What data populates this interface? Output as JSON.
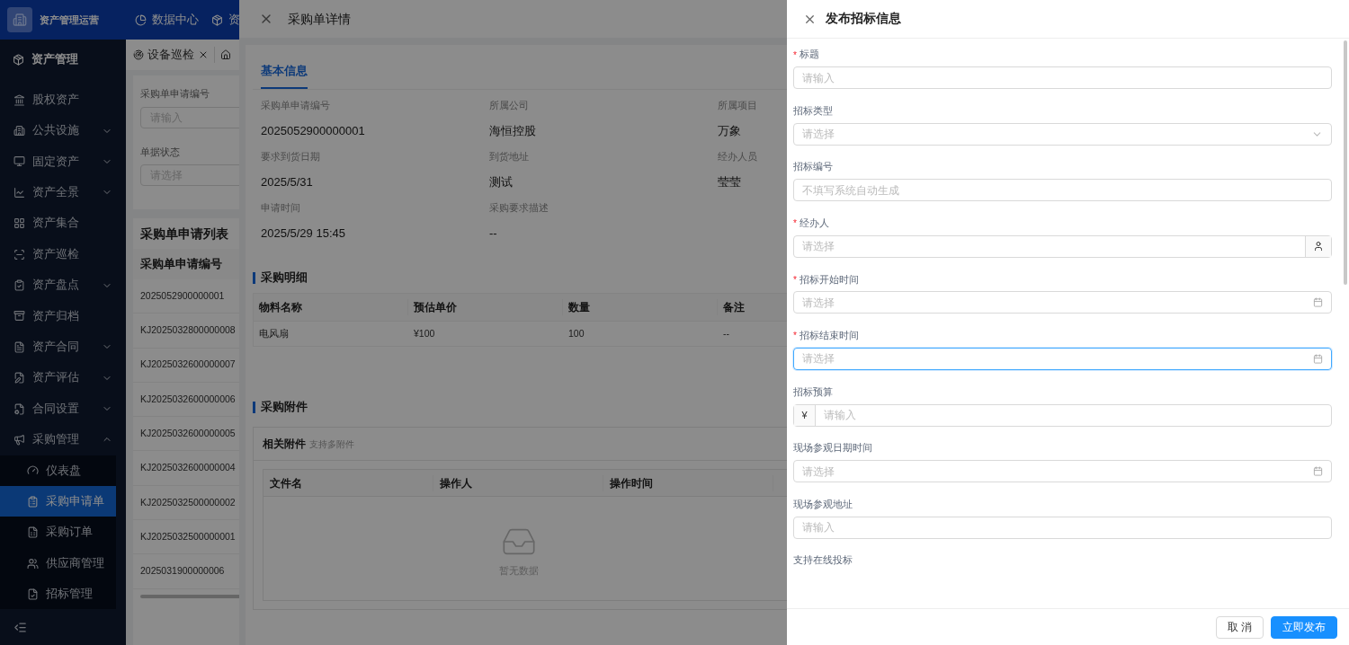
{
  "topbar": {
    "app_name": "资产管理运营",
    "nav": [
      {
        "label": "数据中心"
      },
      {
        "label": "资"
      }
    ]
  },
  "sidebar": {
    "title": "资产管理",
    "items": [
      {
        "label": "股权资产",
        "expandable": false,
        "selected": false
      },
      {
        "label": "公共设施",
        "expandable": true,
        "expanded": false,
        "selected": false
      },
      {
        "label": "固定资产",
        "expandable": true,
        "expanded": false,
        "selected": false
      },
      {
        "label": "资产全景",
        "expandable": true,
        "expanded": false,
        "selected": false
      },
      {
        "label": "资产集合",
        "expandable": false,
        "selected": false
      },
      {
        "label": "资产巡检",
        "expandable": false,
        "selected": false
      },
      {
        "label": "资产盘点",
        "expandable": true,
        "expanded": false,
        "selected": false
      },
      {
        "label": "资产归档",
        "expandable": false,
        "selected": false
      },
      {
        "label": "资产合同",
        "expandable": true,
        "expanded": false,
        "selected": false
      },
      {
        "label": "资产评估",
        "expandable": true,
        "expanded": false,
        "selected": false
      },
      {
        "label": "合同设置",
        "expandable": true,
        "expanded": false,
        "selected": false
      },
      {
        "label": "采购管理",
        "expandable": true,
        "expanded": true,
        "selected": false,
        "children": [
          {
            "label": "仪表盘",
            "selected": false
          },
          {
            "label": "采购申请单",
            "selected": true
          },
          {
            "label": "采购订单",
            "selected": false
          },
          {
            "label": "供应商管理",
            "selected": false
          },
          {
            "label": "招标管理",
            "selected": false
          }
        ]
      }
    ]
  },
  "page_tabs": [
    {
      "label": "设备巡检",
      "closable": true
    }
  ],
  "filters": [
    {
      "label": "采购单申请编号",
      "placeholder": "请输入"
    },
    {
      "label": "单据状态",
      "placeholder": "请选择"
    }
  ],
  "list": {
    "title": "采购单申请列表",
    "column": "采购单申请编号",
    "rows": [
      "2025052900000001",
      "KJ2025032800000008",
      "KJ2025032600000007",
      "KJ2025032600000006",
      "KJ2025032600000005",
      "KJ2025032600000004",
      "KJ2025032500000002",
      "KJ2025032500000001",
      "2025031900000006"
    ]
  },
  "detail_drawer": {
    "title": "采购单详情",
    "tabs": [
      {
        "label": "基本信息",
        "selected": true
      }
    ],
    "fields": [
      {
        "label": "采购单申请编号",
        "value": "2025052900000001"
      },
      {
        "label": "所属公司",
        "value": "海恒控股"
      },
      {
        "label": "所属项目",
        "value": "万象"
      },
      {
        "label": "要求到货日期",
        "value": "2025/5/31"
      },
      {
        "label": "到货地址",
        "value": "测试"
      },
      {
        "label": "经办人员",
        "value": "莹莹"
      },
      {
        "label": "申请时间",
        "value": "2025/5/29 15:45"
      },
      {
        "label": "采购要求描述",
        "value": "--"
      }
    ],
    "items_section": {
      "title": "采购明细",
      "columns": [
        "物料名称",
        "预估单价",
        "数量",
        "备注"
      ],
      "rows": [
        [
          "电风扇",
          "¥100",
          "100",
          "--"
        ]
      ]
    },
    "attachments_section": {
      "title": "采购附件",
      "box_title": "相关附件",
      "box_hint": "支持多附件",
      "columns": [
        "文件名",
        "操作人",
        "操作时间"
      ],
      "empty_text": "暂无数据"
    }
  },
  "publish_drawer": {
    "title": "发布招标信息",
    "required_mark": "*",
    "fields": [
      {
        "label": "标题",
        "required": true,
        "kind": "input",
        "placeholder": "请输入",
        "focused": false
      },
      {
        "label": "招标类型",
        "required": false,
        "kind": "select",
        "placeholder": "请选择",
        "focused": false
      },
      {
        "label": "招标编号",
        "required": false,
        "kind": "input",
        "placeholder": "不填写系统自动生成",
        "focused": false
      },
      {
        "label": "经办人",
        "required": true,
        "kind": "person",
        "placeholder": "请选择",
        "focused": false
      },
      {
        "label": "招标开始时间",
        "required": true,
        "kind": "date",
        "placeholder": "请选择",
        "focused": false
      },
      {
        "label": "招标结束时间",
        "required": true,
        "kind": "date",
        "placeholder": "请选择",
        "focused": true
      },
      {
        "label": "招标预算",
        "required": false,
        "kind": "currency",
        "prefix": "¥",
        "placeholder": "请输入",
        "focused": false
      },
      {
        "label": "现场参观日期时间",
        "required": false,
        "kind": "date",
        "placeholder": "请选择",
        "focused": false
      },
      {
        "label": "现场参观地址",
        "required": false,
        "kind": "input",
        "placeholder": "请输入",
        "focused": false
      },
      {
        "label": "支持在线投标",
        "required": false,
        "kind": "label_only"
      }
    ],
    "buttons": [
      {
        "label": "取 消",
        "kind": "secondary"
      },
      {
        "label": "立即发布",
        "kind": "primary"
      }
    ]
  }
}
